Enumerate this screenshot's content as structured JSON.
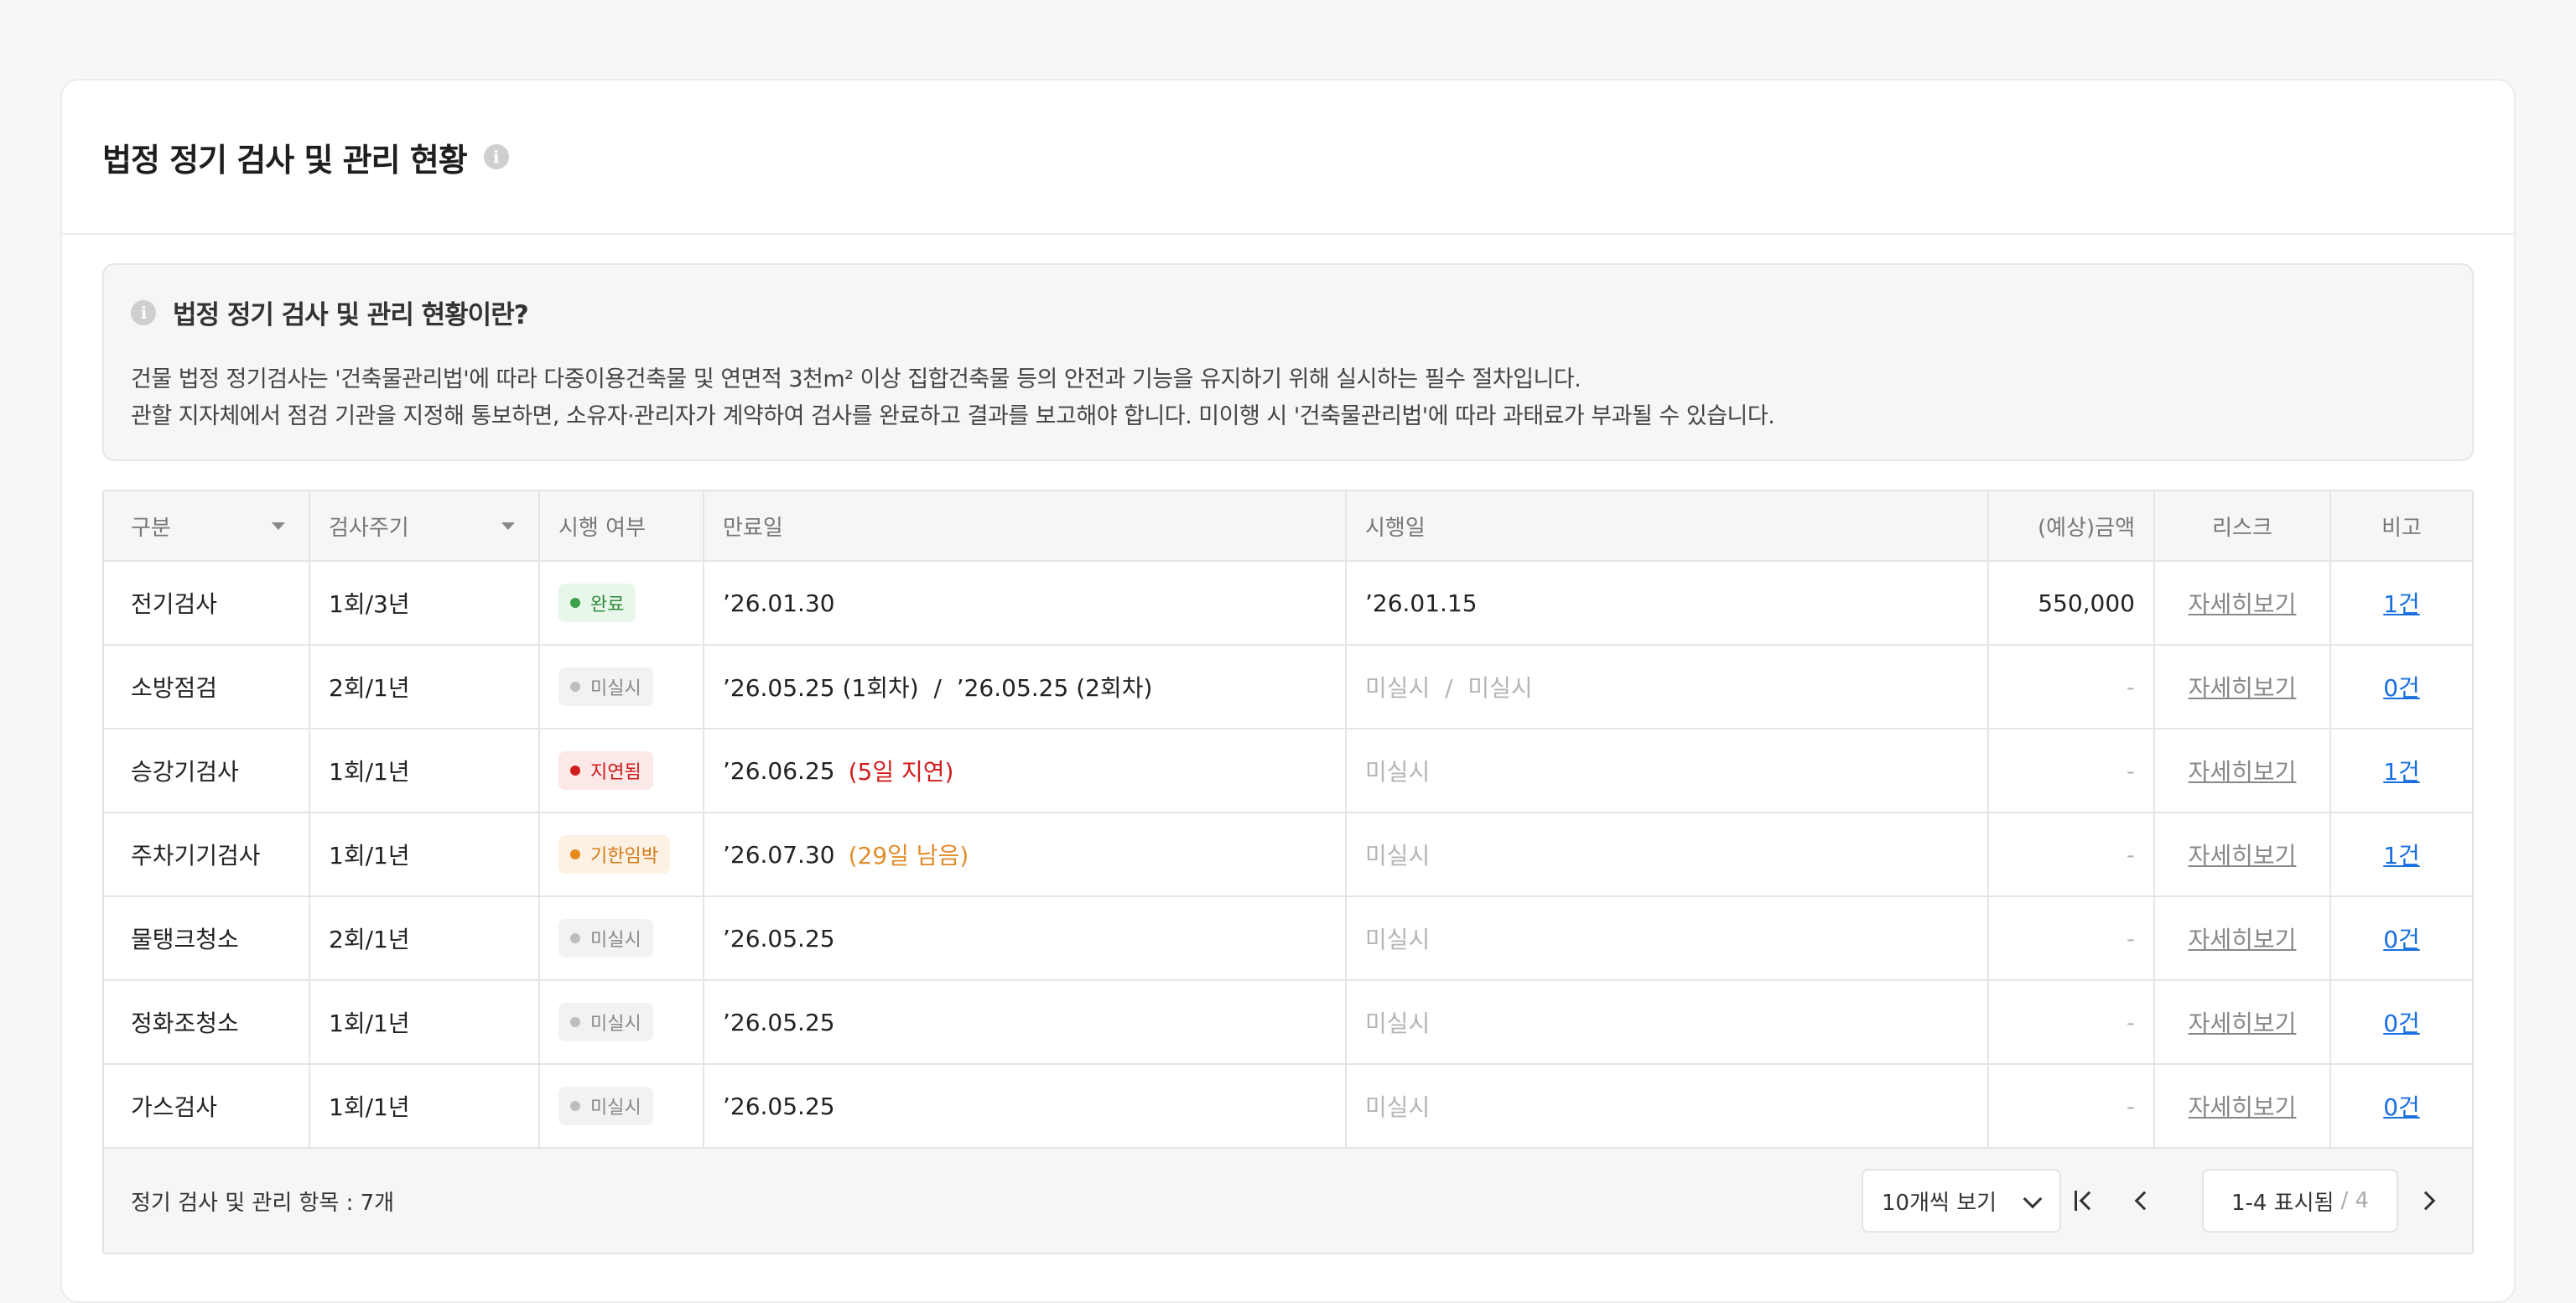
{
  "header": {
    "title": "법정 정기 검사 및 관리 현황",
    "info_icon": "i"
  },
  "info": {
    "title": "법정 정기 검사 및 관리 현황이란?",
    "line1": "건물 법정 정기검사는 '건축물관리법'에 따라 다중이용건축물 및 연면적 3천m² 이상 집합건축물 등의 안전과 기능을 유지하기 위해 실시하는 필수 절차입니다.",
    "line2": "관할 지자체에서 점검 기관을 지정해 통보하면, 소유자·관리자가 계약하여 검사를 완료하고 결과를 보고해야 합니다. 미이행 시 '건축물관리법'에 따라 과태료가 부과될 수 있습니다."
  },
  "table": {
    "columns": [
      "구분",
      "검사주기",
      "시행 여부",
      "만료일",
      "시행일",
      "(예상)금액",
      "리스크",
      "비고"
    ],
    "rows": [
      {
        "type": "전기검사",
        "cycle": "1회/3년",
        "status": "완료",
        "expiry": "’26.01.30",
        "expiry_note": "",
        "exec": "’26.01.15",
        "amount": "550,000",
        "risk": "자세히보기",
        "note": "1건"
      },
      {
        "type": "소방점검",
        "cycle": "2회/1년",
        "status": "미실시",
        "expiry": "’26.05.25 (1회차)  /  ’26.05.25 (2회차)",
        "expiry_note": "",
        "exec": "미실시  /  미실시",
        "amount": "-",
        "risk": "자세히보기",
        "note": "0건"
      },
      {
        "type": "승강기검사",
        "cycle": "1회/1년",
        "status": "지연됨",
        "expiry": "’26.06.25",
        "expiry_note": "(5일 지연)",
        "exec": "미실시",
        "amount": "-",
        "risk": "자세히보기",
        "note": "1건"
      },
      {
        "type": "주차기기검사",
        "cycle": "1회/1년",
        "status": "기한임박",
        "expiry": "’26.07.30",
        "expiry_note": "(29일 남음)",
        "exec": "미실시",
        "amount": "-",
        "risk": "자세히보기",
        "note": "1건"
      },
      {
        "type": "물탱크청소",
        "cycle": "2회/1년",
        "status": "미실시",
        "expiry": "’26.05.25",
        "expiry_note": "",
        "exec": "미실시",
        "amount": "-",
        "risk": "자세히보기",
        "note": "0건"
      },
      {
        "type": "정화조청소",
        "cycle": "1회/1년",
        "status": "미실시",
        "expiry": "’26.05.25",
        "expiry_note": "",
        "exec": "미실시",
        "amount": "-",
        "risk": "자세히보기",
        "note": "0건"
      },
      {
        "type": "가스검사",
        "cycle": "1회/1년",
        "status": "미실시",
        "expiry": "’26.05.25",
        "expiry_note": "",
        "exec": "미실시",
        "amount": "-",
        "risk": "자세히보기",
        "note": "0건"
      }
    ]
  },
  "footer": {
    "total": "정기 검사 및 관리 항목 : 7개",
    "per_page": "10개씩 보기",
    "range": "1-4 표시됨",
    "of": "/ 4"
  },
  "colors": {
    "done": "#3aa04a",
    "late": "#d21d1d",
    "soon": "#e68a1e",
    "link": "#1a6fe0"
  }
}
